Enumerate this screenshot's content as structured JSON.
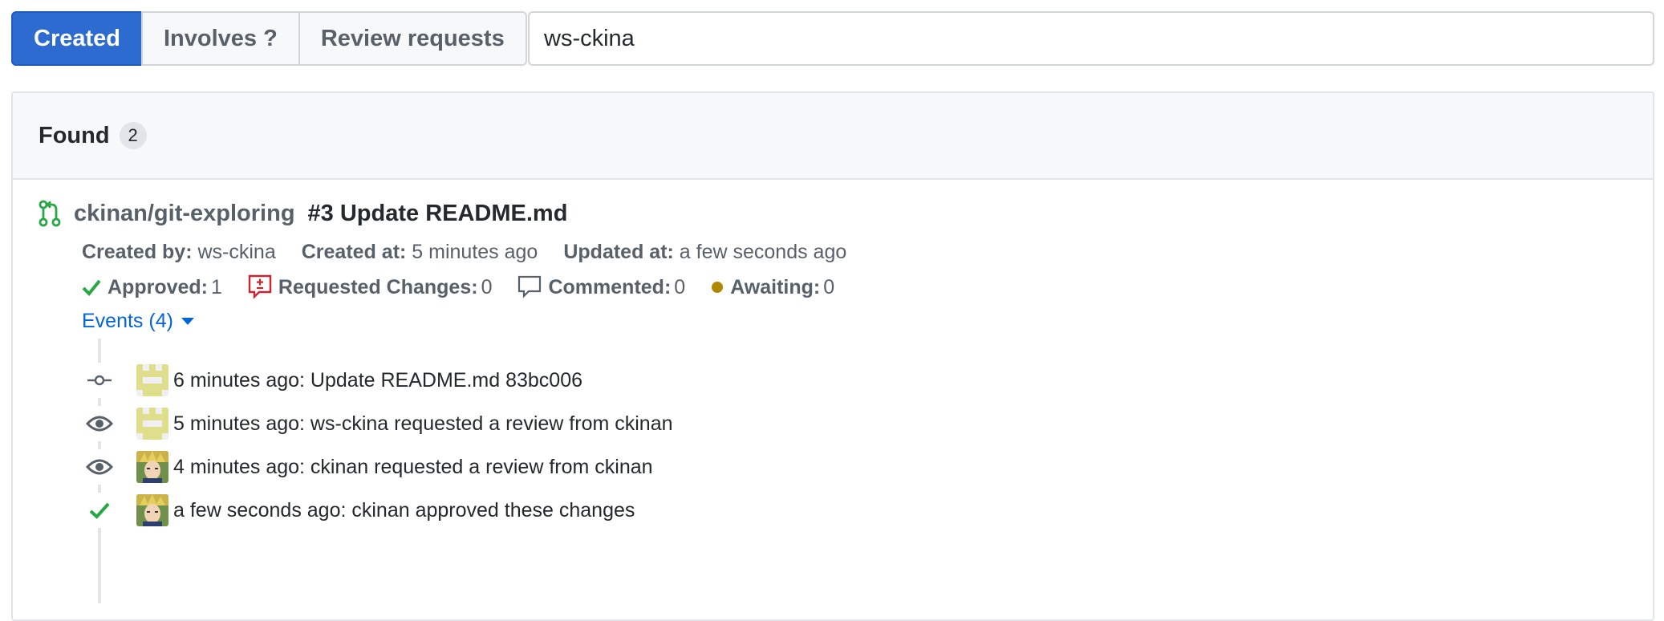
{
  "filters": {
    "tabs": [
      {
        "label": "Created",
        "active": true
      },
      {
        "label": "Involves ?",
        "active": false
      },
      {
        "label": "Review requests",
        "active": false
      }
    ],
    "search_value": "ws-ckina"
  },
  "results": {
    "found_label": "Found",
    "count": "2",
    "items": [
      {
        "repo": "ckinan/git-exploring",
        "title": "#3 Update README.md",
        "created_by_label": "Created by:",
        "created_by": "ws-ckina",
        "created_at_label": "Created at:",
        "created_at": "5 minutes ago",
        "updated_at_label": "Updated at:",
        "updated_at": "a few seconds ago",
        "reviews": {
          "approved_label": "Approved:",
          "approved": "1",
          "changes_label": "Requested Changes:",
          "changes": "0",
          "commented_label": "Commented:",
          "commented": "0",
          "awaiting_label": "Awaiting:",
          "awaiting": "0"
        },
        "events_toggle": "Events (4)",
        "events": [
          {
            "icon": "commit-icon",
            "avatar": "identicon",
            "text": "6 minutes ago: Update README.md 83bc006"
          },
          {
            "icon": "eye-icon",
            "avatar": "identicon",
            "text": "5 minutes ago: ws-ckina requested a review from ckinan"
          },
          {
            "icon": "eye-icon",
            "avatar": "photo",
            "text": "4 minutes ago: ckinan requested a review from ckinan"
          },
          {
            "icon": "check-icon",
            "avatar": "photo",
            "text": "a few seconds ago: ckinan approved these changes"
          }
        ]
      }
    ]
  },
  "colors": {
    "primary": "#2d6bd0",
    "link": "#0366d6",
    "success": "#28a745",
    "danger": "#cb2431",
    "awaiting": "#b08800"
  }
}
